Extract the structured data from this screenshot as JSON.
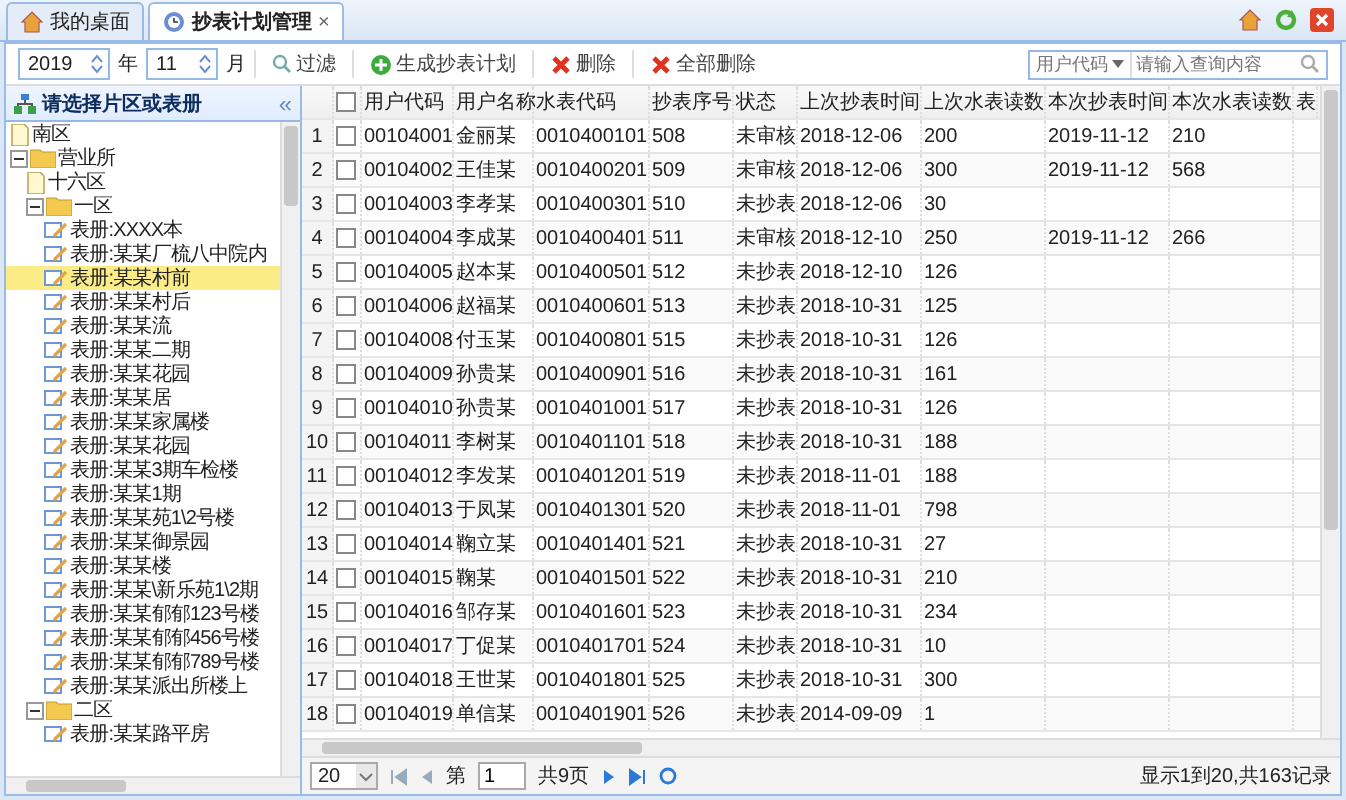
{
  "tabs": [
    {
      "label": "我的桌面",
      "kind": "home",
      "selected": false
    },
    {
      "label": "抄表计划管理",
      "kind": "plan",
      "selected": true,
      "close": "×"
    }
  ],
  "toolbar": {
    "year": "2019",
    "year_unit": "年",
    "month": "11",
    "month_unit": "月",
    "buttons": [
      {
        "label": "过滤",
        "kind": "filter"
      },
      {
        "label": "生成抄表计划",
        "kind": "add"
      },
      {
        "label": "删除",
        "kind": "delete"
      },
      {
        "label": "全部删除",
        "kind": "delete_all"
      }
    ],
    "search_field": "用户代码",
    "search_placeholder": "请输入查询内容"
  },
  "sidebar": {
    "title": "请选择片区或表册",
    "collapse": "«",
    "tree": [
      {
        "label": "南区",
        "kind": "file"
      },
      {
        "label": "营业所",
        "kind": "folder",
        "expanded": true,
        "children": [
          {
            "label": "十六区",
            "kind": "file"
          },
          {
            "label": "一区",
            "kind": "folder",
            "expanded": true,
            "children": [
              {
                "label": "表册:XXXX本",
                "kind": "book",
                "selected": false
              },
              {
                "label": "表册:某某厂梳八中院内",
                "kind": "book",
                "selected": false
              },
              {
                "label": "表册:某某村前",
                "kind": "book",
                "selected": true
              },
              {
                "label": "表册:某某村后",
                "kind": "book",
                "selected": false
              },
              {
                "label": "表册:某某流",
                "kind": "book",
                "selected": false
              },
              {
                "label": "表册:某某二期",
                "kind": "book",
                "selected": false
              },
              {
                "label": "表册:某某花园",
                "kind": "book",
                "selected": false
              },
              {
                "label": "表册:某某居",
                "kind": "book",
                "selected": false
              },
              {
                "label": "表册:某某家属楼",
                "kind": "book",
                "selected": false
              },
              {
                "label": "表册:某某花园",
                "kind": "book",
                "selected": false
              },
              {
                "label": "表册:某某3期车检楼",
                "kind": "book",
                "selected": false
              },
              {
                "label": "表册:某某1期",
                "kind": "book",
                "selected": false
              },
              {
                "label": "表册:某某苑1\\2号楼",
                "kind": "book",
                "selected": false
              },
              {
                "label": "表册:某某御景园",
                "kind": "book",
                "selected": false
              },
              {
                "label": "表册:某某楼",
                "kind": "book",
                "selected": false
              },
              {
                "label": "表册:某某\\新乐苑1\\2期",
                "kind": "book",
                "selected": false
              },
              {
                "label": "表册:某某郁郁123号楼",
                "kind": "book",
                "selected": false
              },
              {
                "label": "表册:某某郁郁456号楼",
                "kind": "book",
                "selected": false
              },
              {
                "label": "表册:某某郁郁789号楼",
                "kind": "book",
                "selected": false
              },
              {
                "label": "表册:某某派出所楼上",
                "kind": "book",
                "selected": false
              }
            ]
          },
          {
            "label": "二区",
            "kind": "folder",
            "expanded": true,
            "children": [
              {
                "label": "表册:某某路平房",
                "kind": "book",
                "selected": false
              }
            ]
          }
        ]
      }
    ]
  },
  "table": {
    "all_checked": false,
    "columns": [
      "用户代码",
      "用户名称",
      "水表代码",
      "抄表序号",
      "状态",
      "上次抄表时间",
      "上次水表读数",
      "本次抄表时间",
      "本次水表读数",
      "表"
    ],
    "rows": [
      {
        "index": "1",
        "checked": false,
        "cells": [
          "00104001",
          "金丽某",
          "0010400101",
          "508",
          "未审核",
          "2018-12-06",
          "200",
          "2019-11-12",
          "210"
        ]
      },
      {
        "index": "2",
        "checked": false,
        "cells": [
          "00104002",
          "王佳某",
          "0010400201",
          "509",
          "未审核",
          "2018-12-06",
          "300",
          "2019-11-12",
          "568"
        ]
      },
      {
        "index": "3",
        "checked": false,
        "cells": [
          "00104003",
          "李孝某",
          "0010400301",
          "510",
          "未抄表",
          "2018-12-06",
          "30",
          "",
          ""
        ]
      },
      {
        "index": "4",
        "checked": false,
        "cells": [
          "00104004",
          "李成某",
          "0010400401",
          "511",
          "未审核",
          "2018-12-10",
          "250",
          "2019-11-12",
          "266"
        ]
      },
      {
        "index": "5",
        "checked": false,
        "cells": [
          "00104005",
          "赵本某",
          "0010400501",
          "512",
          "未抄表",
          "2018-12-10",
          "126",
          "",
          ""
        ]
      },
      {
        "index": "6",
        "checked": false,
        "cells": [
          "00104006",
          "赵福某",
          "0010400601",
          "513",
          "未抄表",
          "2018-10-31",
          "125",
          "",
          ""
        ]
      },
      {
        "index": "7",
        "checked": false,
        "cells": [
          "00104008",
          "付玉某",
          "0010400801",
          "515",
          "未抄表",
          "2018-10-31",
          "126",
          "",
          ""
        ]
      },
      {
        "index": "8",
        "checked": false,
        "cells": [
          "00104009",
          "孙贵某",
          "0010400901",
          "516",
          "未抄表",
          "2018-10-31",
          "161",
          "",
          ""
        ]
      },
      {
        "index": "9",
        "checked": false,
        "cells": [
          "00104010",
          "孙贵某",
          "0010401001",
          "517",
          "未抄表",
          "2018-10-31",
          "126",
          "",
          ""
        ]
      },
      {
        "index": "10",
        "checked": false,
        "cells": [
          "00104011",
          "李树某",
          "0010401101",
          "518",
          "未抄表",
          "2018-10-31",
          "188",
          "",
          ""
        ]
      },
      {
        "index": "11",
        "checked": false,
        "cells": [
          "00104012",
          "李发某",
          "0010401201",
          "519",
          "未抄表",
          "2018-11-01",
          "188",
          "",
          ""
        ]
      },
      {
        "index": "12",
        "checked": false,
        "cells": [
          "00104013",
          "于凤某",
          "0010401301",
          "520",
          "未抄表",
          "2018-11-01",
          "798",
          "",
          ""
        ]
      },
      {
        "index": "13",
        "checked": false,
        "cells": [
          "00104014",
          "鞠立某",
          "0010401401",
          "521",
          "未抄表",
          "2018-10-31",
          "27",
          "",
          ""
        ]
      },
      {
        "index": "14",
        "checked": false,
        "cells": [
          "00104015",
          "鞠某",
          "0010401501",
          "522",
          "未抄表",
          "2018-10-31",
          "210",
          "",
          ""
        ]
      },
      {
        "index": "15",
        "checked": false,
        "cells": [
          "00104016",
          "邹存某",
          "0010401601",
          "523",
          "未抄表",
          "2018-10-31",
          "234",
          "",
          ""
        ]
      },
      {
        "index": "16",
        "checked": false,
        "cells": [
          "00104017",
          "丁促某",
          "0010401701",
          "524",
          "未抄表",
          "2018-10-31",
          "10",
          "",
          ""
        ]
      },
      {
        "index": "17",
        "checked": false,
        "cells": [
          "00104018",
          "王世某",
          "0010401801",
          "525",
          "未抄表",
          "2018-10-31",
          "300",
          "",
          ""
        ]
      },
      {
        "index": "18",
        "checked": false,
        "cells": [
          "00104019",
          "单信某",
          "0010401901",
          "526",
          "未抄表",
          "2014-09-09",
          "1",
          "",
          ""
        ]
      }
    ]
  },
  "pager": {
    "page_size": "20",
    "page_label": "第",
    "page": "1",
    "total_pages": "共9页",
    "summary": "显示1到20,共163记录"
  }
}
